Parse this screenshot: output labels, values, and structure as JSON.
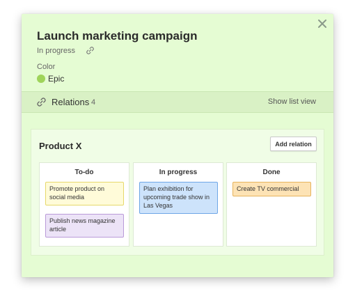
{
  "card": {
    "title": "Launch marketing campaign",
    "status": "In progress",
    "color_label": "Color",
    "color_name": "Epic",
    "color_hex": "#9fd45a",
    "background_hex": "#e5fcd3"
  },
  "relations": {
    "title": "Relations",
    "count": "4",
    "show_list_label": "Show list view",
    "product": "Product X",
    "add_relation_label": "Add relation",
    "columns": [
      {
        "header": "To-do",
        "tasks": [
          {
            "text": "Promote product on social media",
            "color": "yellow"
          },
          {
            "text": "Publish news magazine article",
            "color": "purple"
          }
        ]
      },
      {
        "header": "In progress",
        "tasks": [
          {
            "text": "Plan exhibition for upcoming trade show in Las Vegas",
            "color": "blue"
          }
        ]
      },
      {
        "header": "Done",
        "tasks": [
          {
            "text": "Create TV commercial",
            "color": "orange"
          }
        ]
      }
    ]
  },
  "icons": {
    "close": "close-icon",
    "link": "link-icon"
  }
}
